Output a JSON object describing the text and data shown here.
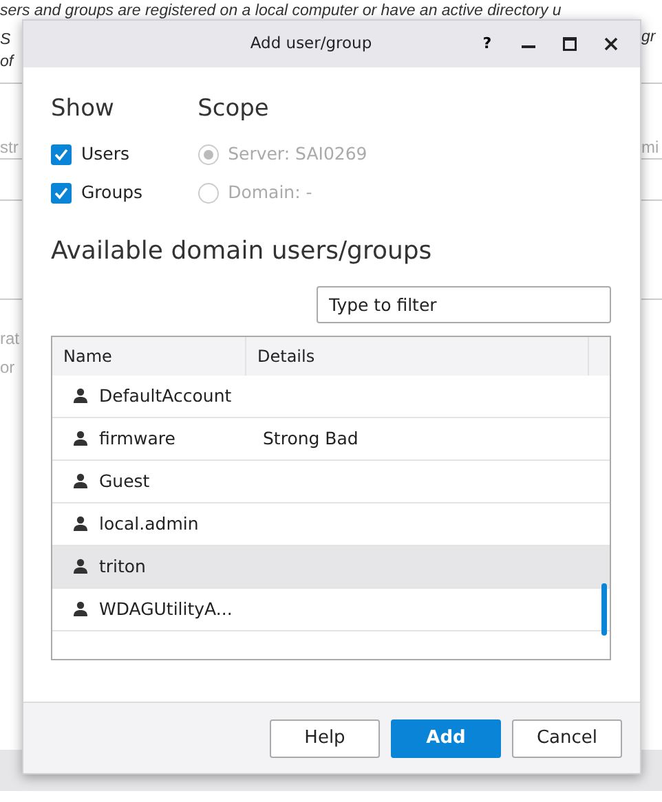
{
  "background": {
    "fragments": [
      {
        "text": "sers and groups are registered on a local computer or have an active directory u",
        "kind": "line"
      },
      {
        "text": "S",
        "kind": "left2"
      },
      {
        "text": "gr",
        "kind": "right2"
      },
      {
        "text": "of",
        "kind": "left3"
      },
      {
        "text": "str",
        "kind": "leftcol"
      },
      {
        "text": "mi",
        "kind": "rightcol"
      },
      {
        "text": "rat",
        "kind": "left4"
      },
      {
        "text": "or",
        "kind": "left5"
      }
    ]
  },
  "window": {
    "title": "Add user/group",
    "controls": [
      "?"
    ]
  },
  "show": {
    "heading": "Show",
    "options": [
      {
        "label": "Users",
        "checked": true
      },
      {
        "label": "Groups",
        "checked": true
      }
    ]
  },
  "scope": {
    "heading": "Scope",
    "options": [
      {
        "label": "Server: SAI0269",
        "selected": true,
        "disabled": true
      },
      {
        "label": "Domain: -",
        "selected": false,
        "disabled": true
      }
    ]
  },
  "list_heading": "Available domain users/groups",
  "filter": {
    "placeholder": "Type to filter"
  },
  "table": {
    "columns": [
      "Name",
      "Details"
    ],
    "rows": [
      {
        "name": "DefaultAccount",
        "selected": false
      },
      {
        "name": "firmware",
        "details": "Strong Bad",
        "selected": false
      },
      {
        "name": "Guest",
        "selected": false
      },
      {
        "name": "local.admin",
        "selected": false
      },
      {
        "name": "triton",
        "selected": true
      },
      {
        "name": "WDAGUtilityA...",
        "selected": false
      }
    ]
  },
  "buttons": [
    {
      "label": "Help",
      "kind": "default"
    },
    {
      "label": "Add",
      "kind": "primary"
    },
    {
      "label": "Cancel",
      "kind": "default"
    }
  ]
}
